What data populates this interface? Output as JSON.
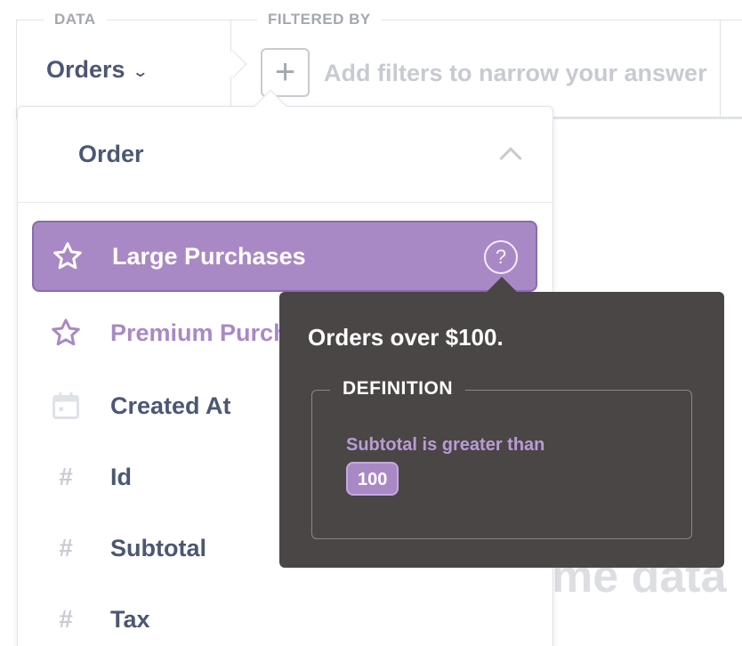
{
  "builder": {
    "data_label": "DATA",
    "filtered_by_label": "FILTERED BY",
    "source": "Orders",
    "filter_placeholder": "Add filters to narrow your answer",
    "add_filter_symbol": "+"
  },
  "background_text": "me data l",
  "popover": {
    "table_name": "Order",
    "items": [
      {
        "label": "Large Purchases",
        "icon": "star-icon",
        "type": "segment",
        "selected": true
      },
      {
        "label": "Premium Purchases",
        "icon": "star-icon",
        "type": "segment",
        "selected": false
      },
      {
        "label": "Created At",
        "icon": "calendar-icon",
        "type": "field",
        "selected": false
      },
      {
        "label": "Id",
        "icon": "hash-icon",
        "type": "field",
        "selected": false
      },
      {
        "label": "Subtotal",
        "icon": "hash-icon",
        "type": "field",
        "selected": false
      },
      {
        "label": "Tax",
        "icon": "hash-icon",
        "type": "field",
        "selected": false
      }
    ]
  },
  "tooltip": {
    "description": "Orders over $100.",
    "definition_label": "DEFINITION",
    "condition": "Subtotal is greater than",
    "value": "100"
  },
  "colors": {
    "brand_purple": "#a989c5",
    "tooltip_bg": "#4a4645",
    "text_dark": "#4c5773",
    "text_muted": "#c7cbd1"
  }
}
